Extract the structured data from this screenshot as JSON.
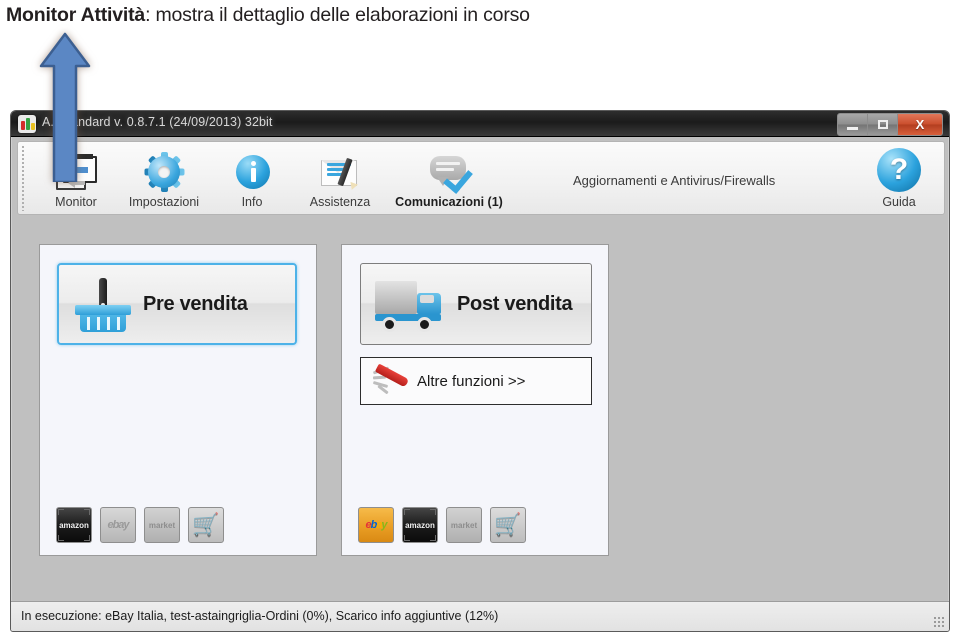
{
  "caption": {
    "bold_part": "Monitor Attività",
    "rest_part": ": mostra il dettaglio delle elaborazioni in corso"
  },
  "window": {
    "title": "A...standard v. 0.8.7.1 (24/09/2013) 32bit",
    "app_icon": "app-logo-icon",
    "controls": {
      "minimize": "minimize-icon",
      "maximize": "maximize-icon",
      "close": "X"
    }
  },
  "toolbar": {
    "items": [
      {
        "label": "Monitor",
        "icon": "monitor-icon",
        "bold": false
      },
      {
        "label": "Impostazioni",
        "icon": "gear-icon",
        "bold": false
      },
      {
        "label": "Info",
        "icon": "info-icon",
        "bold": false
      },
      {
        "label": "Assistenza",
        "icon": "envelope-pencil-icon",
        "bold": false
      },
      {
        "label": "Comunicazioni (1)",
        "icon": "speech-check-icon",
        "bold": true
      }
    ],
    "middle_label": "Aggiornamenti e Antivirus/Firewalls",
    "help": {
      "label": "Guida",
      "icon": "question-mark-icon",
      "glyph": "?"
    }
  },
  "panels": {
    "pre": {
      "button": {
        "label": "Pre vendita",
        "icon": "shopping-basket-icon",
        "selected": true
      },
      "marketplaces": [
        {
          "name": "amazon-icon",
          "style": "amazon-dark",
          "text": "amazon"
        },
        {
          "name": "ebay-icon",
          "style": "ebay-gray",
          "text": "ebay"
        },
        {
          "name": "mercateo-icon",
          "style": "gray-mp",
          "text": "market"
        },
        {
          "name": "cart-icon",
          "style": "cart",
          "text": "\u0000"
        }
      ]
    },
    "post": {
      "button": {
        "label": "Post vendita",
        "icon": "delivery-truck-icon",
        "selected": false
      },
      "secondary_button": {
        "label": "Altre funzioni >>",
        "icon": "swiss-knife-icon"
      },
      "marketplaces": [
        {
          "name": "ebay-icon",
          "style": "ebay-color",
          "text": "ebay"
        },
        {
          "name": "amazon-icon",
          "style": "amazon-dark",
          "text": "amazon"
        },
        {
          "name": "mercateo-icon",
          "style": "gray-mp",
          "text": "market"
        },
        {
          "name": "cart-icon",
          "style": "cart",
          "text": "\u0000"
        }
      ]
    }
  },
  "statusbar": {
    "text": "In esecuzione: eBay Italia, test-astaingriglia-Ordini (0%), Scarico info aggiuntive (12%)",
    "grip": "resize-grip-icon"
  },
  "annotation": {
    "arrow": "up-arrow-annotation",
    "color": "#5b87c4"
  },
  "colors": {
    "window_bg": "#c0c0c0",
    "panel_bg": "#f5f6fb",
    "toolbar_bg": "#f1f1f1",
    "accent_blue": "#4db2e8",
    "close_red": "#c94d2c",
    "arrow_blue": "#5b87c4"
  }
}
